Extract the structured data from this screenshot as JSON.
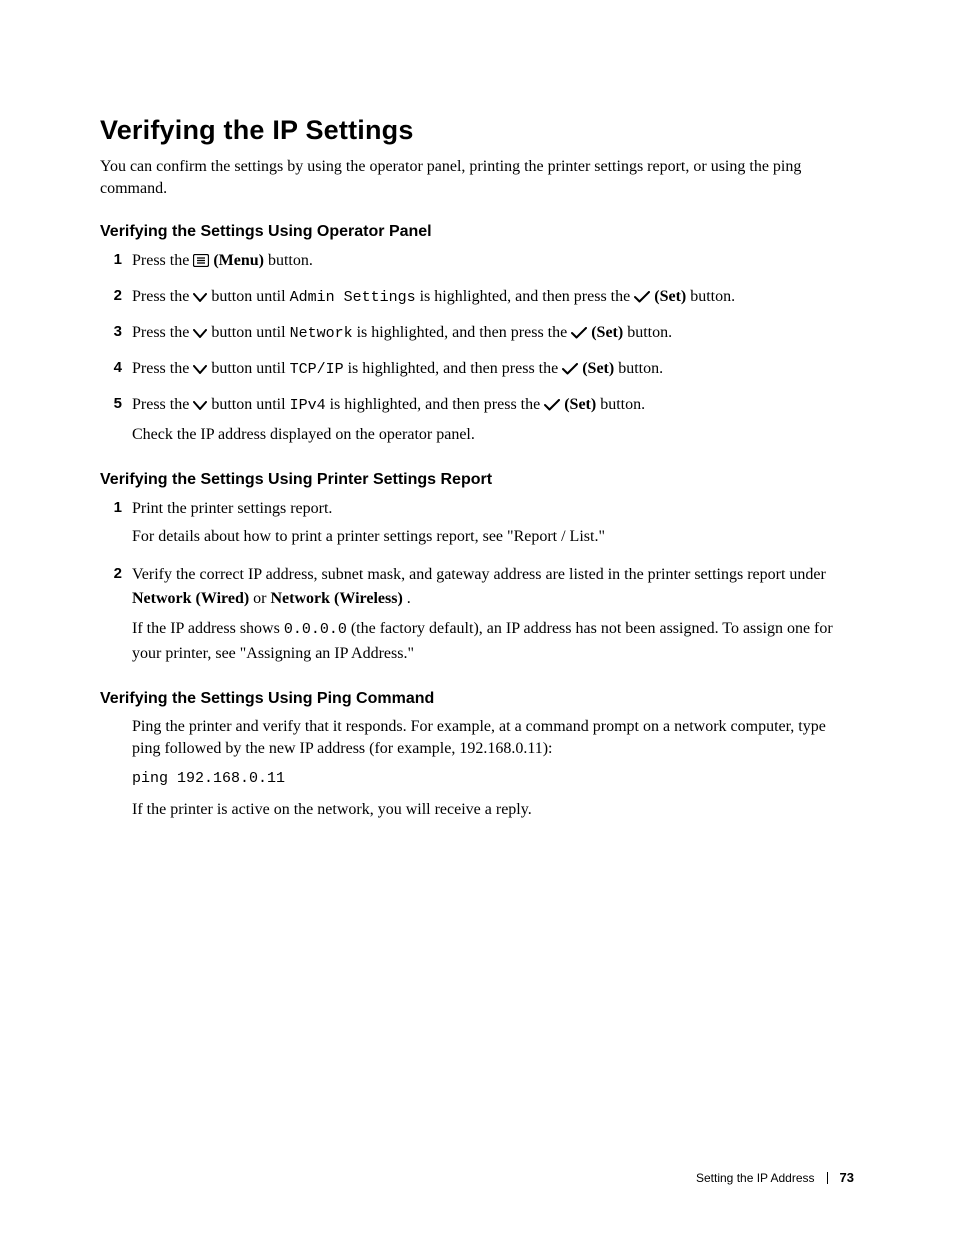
{
  "title": "Verifying the IP Settings",
  "intro": "You can confirm the settings by using the operator panel, printing the printer settings report, or using the ping command.",
  "section1": {
    "heading": "Verifying the Settings Using Operator Panel",
    "steps": {
      "n1": "1",
      "s1_a": "Press the ",
      "s1_b": " (Menu)",
      "s1_c": " button.",
      "n2": "2",
      "s2_a": "Press the ",
      "s2_b": " button until ",
      "s2_c": "Admin Settings",
      "s2_d": " is highlighted, and then press the ",
      "s2_e": " (Set)",
      "s2_f": " button.",
      "n3": "3",
      "s3_a": "Press the ",
      "s3_b": " button until ",
      "s3_c": "Network",
      "s3_d": " is highlighted, and then press the ",
      "s3_e": " (Set)",
      "s3_f": " button.",
      "n4": "4",
      "s4_a": "Press the ",
      "s4_b": " button until ",
      "s4_c": "TCP/IP",
      "s4_d": " is highlighted, and then press the ",
      "s4_e": " (Set)",
      "s4_f": " button.",
      "n5": "5",
      "s5_a": "Press the ",
      "s5_b": " button until ",
      "s5_c": "IPv4",
      "s5_d": " is highlighted, and then press the ",
      "s5_e": " (Set)",
      "s5_f": " button.",
      "s5_g": "Check the IP address displayed on the operator panel."
    }
  },
  "section2": {
    "heading": "Verifying the Settings Using Printer Settings Report",
    "n1": "1",
    "s1_a": "Print the printer settings report.",
    "s1_b": "For details about how to print a printer settings report, see \"Report / List.\"",
    "n2": "2",
    "s2_a": "Verify the correct IP address, subnet mask, and gateway address are listed in the printer settings report under ",
    "s2_b": "Network (Wired)",
    "s2_c": " or ",
    "s2_d": "Network (Wireless)",
    "s2_e": ".",
    "s2_f": "If the IP address shows ",
    "s2_g": "0.0.0.0",
    "s2_h": " (the factory default), an IP address has not been assigned. To assign one for your printer, see \"Assigning an IP Address.\""
  },
  "section3": {
    "heading": "Verifying the Settings Using Ping Command",
    "p1": "Ping the printer and verify that it responds. For example, at a command prompt on a network computer, type ping followed by the new IP address (for example, 192.168.0.11):",
    "code": "ping 192.168.0.11",
    "p2": "If the printer is active on the network, you will receive a reply."
  },
  "footer": {
    "chapter": "Setting the IP Address",
    "page": "73"
  }
}
